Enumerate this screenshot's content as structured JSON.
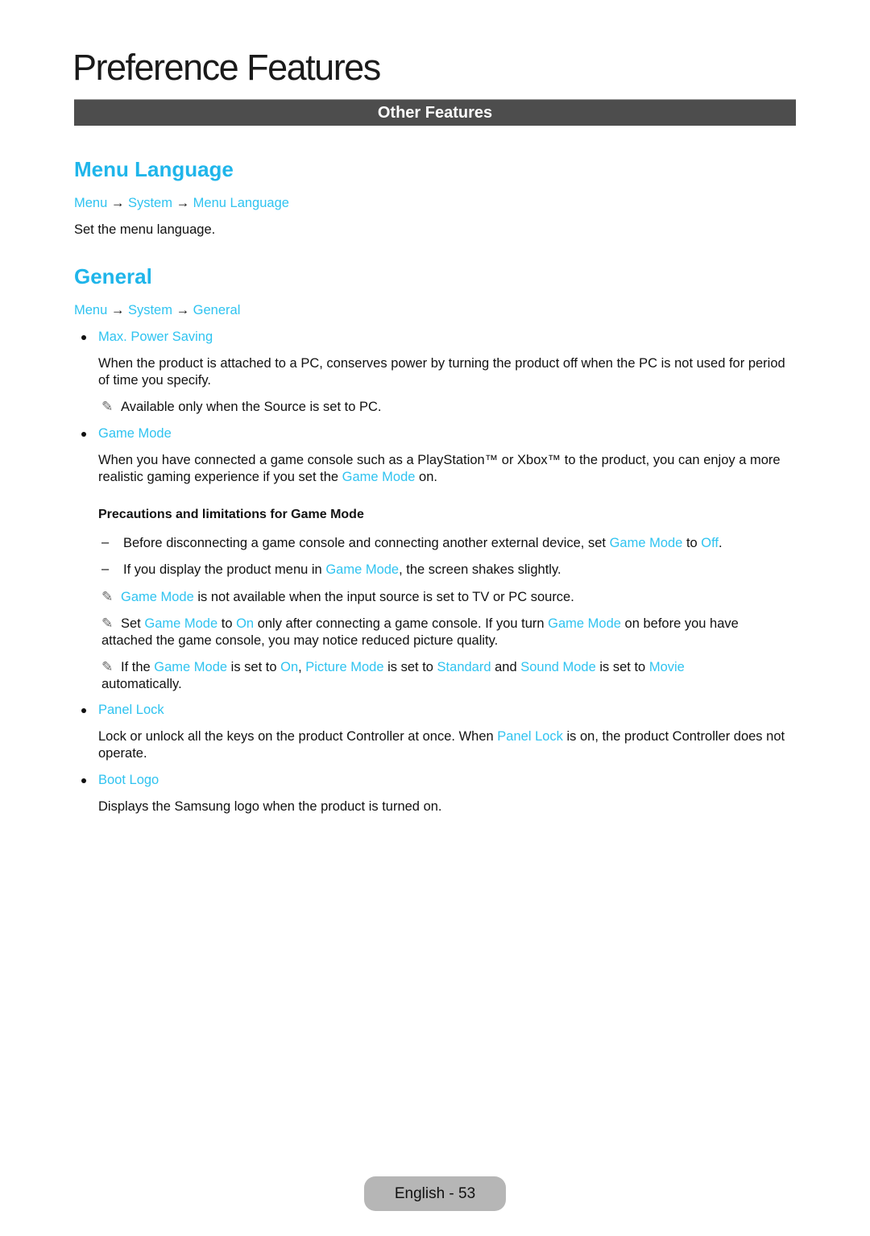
{
  "page": {
    "title": "Preference Features",
    "section_bar": "Other Features",
    "footer": "English - 53",
    "accent_color": "#2fc3f0"
  },
  "menu_language": {
    "heading": "Menu Language",
    "breadcrumb": [
      "Menu",
      "System",
      "Menu Language"
    ],
    "arrow": "→",
    "description": "Set the menu language."
  },
  "general": {
    "heading": "General",
    "breadcrumb": [
      "Menu",
      "System",
      "General"
    ],
    "arrow": "→",
    "items": [
      {
        "label": "Max. Power Saving",
        "description": "When the product is attached to a PC, conserves power by turning the product off when the PC is not used for period of time you specify.",
        "note": "Available only when the Source is set to PC."
      },
      {
        "label": "Game Mode",
        "desc_pre": "When you have connected a game console such as a PlayStation™ or Xbox™ to the product, you can enjoy a more realistic gaming experience if you set the ",
        "desc_link": "Game Mode",
        "desc_post": " on.",
        "precautions_title": "Precautions and limitations for Game Mode",
        "dash1": {
          "pre": "Before disconnecting a game console and connecting another external device, set ",
          "link1": "Game Mode",
          "mid": " to ",
          "link2": "Off",
          "post": "."
        },
        "dash2": {
          "pre": "If you display the product menu in ",
          "link1": "Game Mode",
          "post": ", the screen shakes slightly."
        },
        "note1": {
          "link1": "Game Mode",
          "post": " is not available when the input source is set to TV or PC source."
        },
        "note2": {
          "pre": "Set ",
          "link1": "Game Mode",
          "mid1": " to ",
          "link2": "On",
          "mid2": " only after connecting a game console. If you turn ",
          "link3": "Game Mode",
          "post": " on before you have attached the game console, you may notice reduced picture quality."
        },
        "note3": {
          "pre": "If the ",
          "link1": "Game Mode",
          "mid1": " is set to ",
          "link2": "On",
          "mid2": ", ",
          "link3": "Picture Mode",
          "mid3": " is set to ",
          "link4": "Standard",
          "mid4": " and ",
          "link5": "Sound Mode",
          "mid5": " is set to ",
          "link6": "Movie",
          "post": " automatically."
        }
      },
      {
        "label": "Panel Lock",
        "desc_pre": "Lock or unlock all the keys on the product Controller at once. When ",
        "desc_link": "Panel Lock",
        "desc_post": " is on, the product Controller does not operate."
      },
      {
        "label": "Boot Logo",
        "description": "Displays the Samsung logo when the product is turned on."
      }
    ]
  },
  "icons": {
    "note": "✎",
    "dash": "–"
  }
}
